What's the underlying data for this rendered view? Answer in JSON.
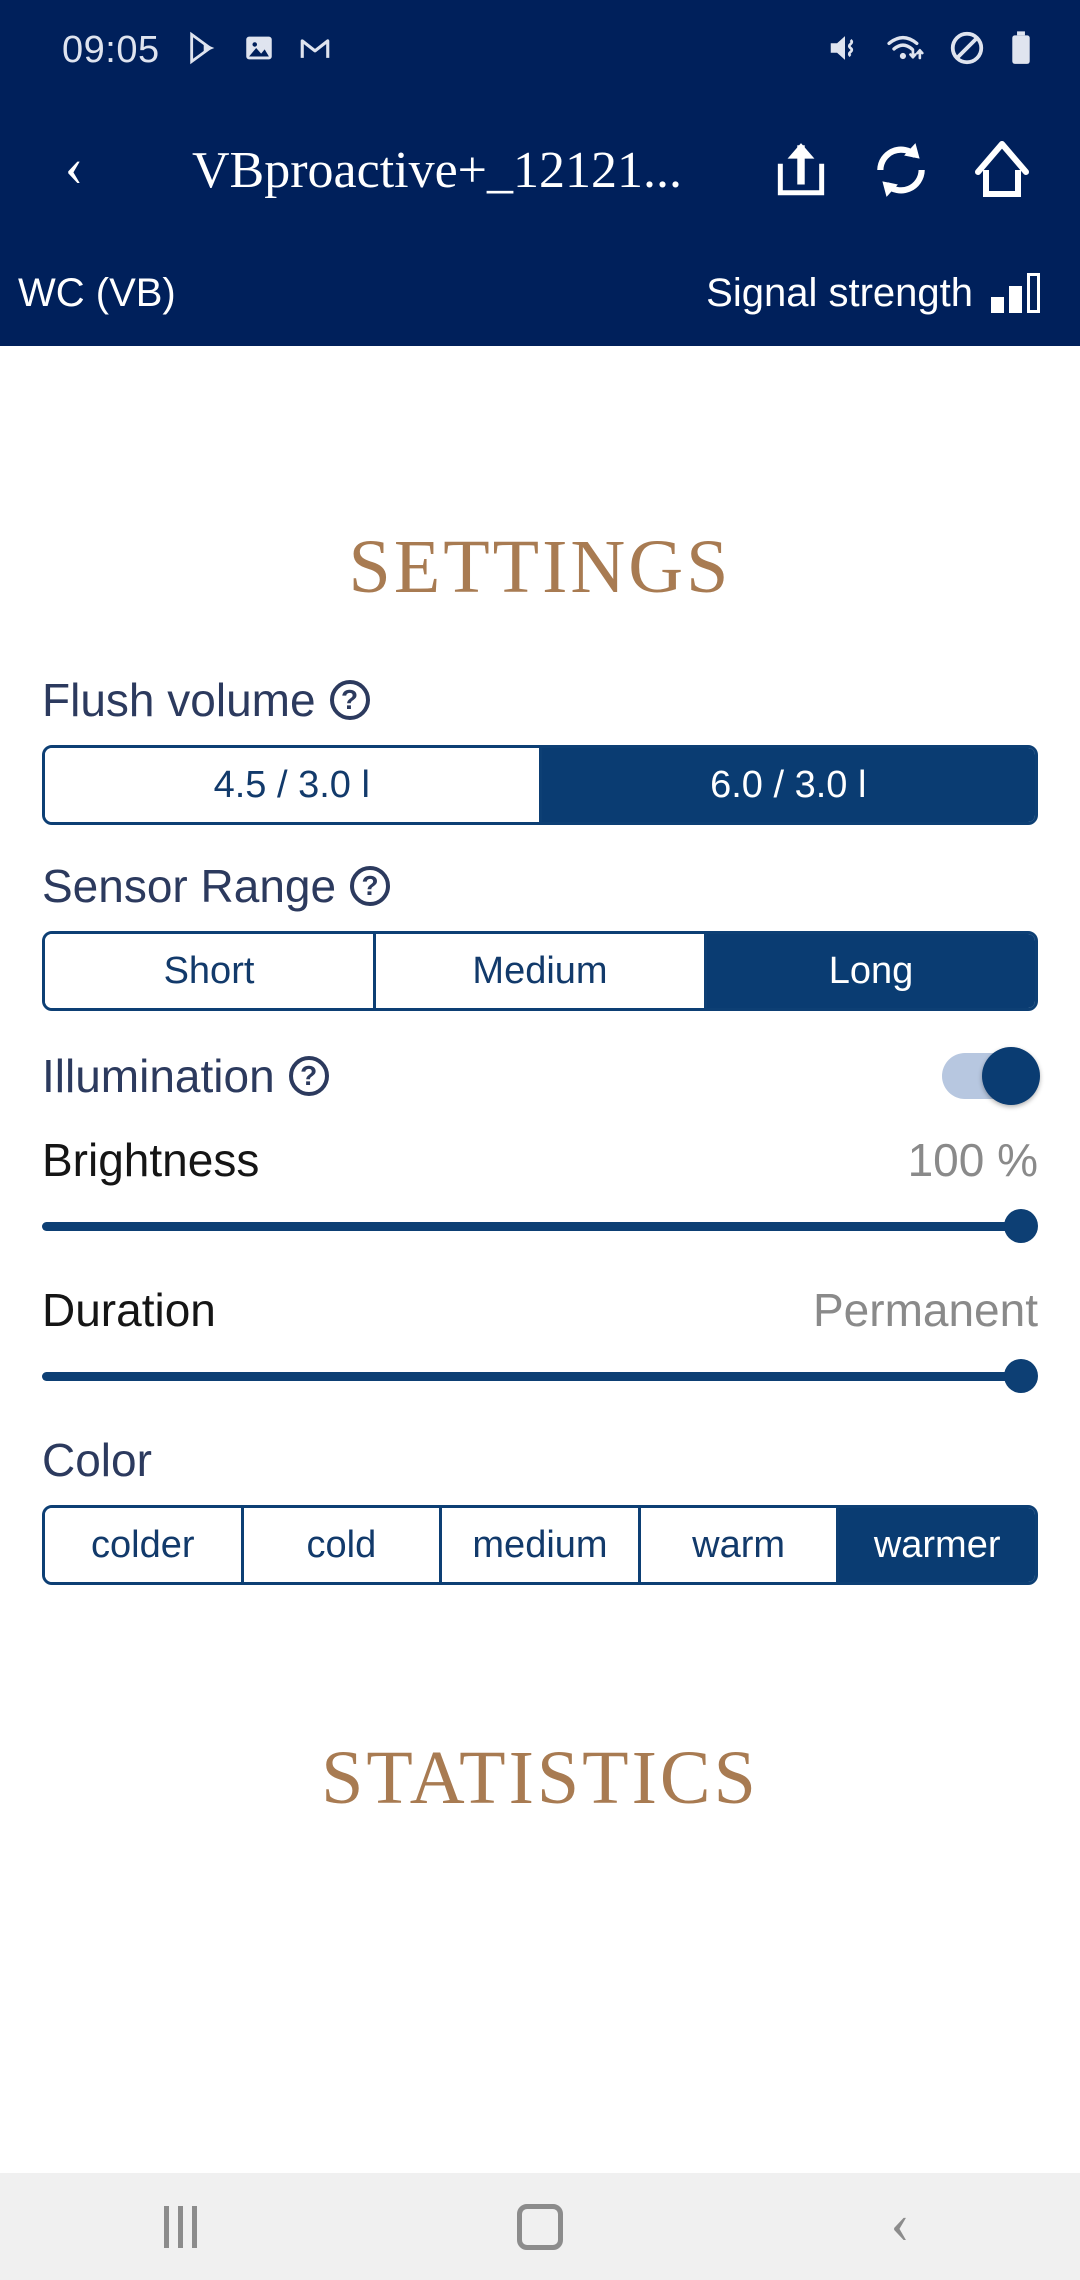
{
  "status_bar": {
    "clock": "09:05",
    "left_icons": [
      "play-store-icon",
      "photos-icon",
      "gmail-icon"
    ],
    "right_icons": [
      "vibrate-mute-icon",
      "wifi-icon",
      "do-not-disturb-icon",
      "battery-icon"
    ]
  },
  "app_bar": {
    "back_label": "‹",
    "title": "VBproactive+_12121...",
    "actions": [
      {
        "name": "share-icon"
      },
      {
        "name": "refresh-icon"
      },
      {
        "name": "home-icon"
      }
    ]
  },
  "sub_bar": {
    "device_label": "WC (VB)",
    "signal_label": "Signal strength",
    "signal_bars": 2,
    "signal_bars_total": 3
  },
  "settings": {
    "heading": "SETTINGS",
    "flush_volume": {
      "label": "Flush volume",
      "help": "?",
      "options": [
        "4.5 / 3.0 l",
        "6.0 / 3.0 l"
      ],
      "selected": "6.0 / 3.0 l",
      "selected_index": 1
    },
    "sensor_range": {
      "label": "Sensor Range",
      "help": "?",
      "options": [
        "Short",
        "Medium",
        "Long"
      ],
      "selected": "Long",
      "selected_index": 2
    },
    "illumination": {
      "label": "Illumination",
      "help": "?",
      "enabled": true
    },
    "brightness": {
      "label": "Brightness",
      "value": "100 %",
      "percent": 100
    },
    "duration": {
      "label": "Duration",
      "value": "Permanent",
      "percent": 100
    },
    "color": {
      "label": "Color",
      "options": [
        "colder",
        "cold",
        "medium",
        "warm",
        "warmer"
      ],
      "selected": "warmer",
      "selected_index": 4
    }
  },
  "statistics": {
    "heading": "STATISTICS"
  },
  "nav_bar": {
    "recents": "recents-icon",
    "home": "home-square-icon",
    "back": "‹"
  },
  "colors": {
    "header_navy": "#00205b",
    "accent_blue": "#0a3c72",
    "heading_bronze": "#a87b52",
    "label_navy": "#2c3a5e",
    "muted_gray": "#8a8a8a"
  }
}
